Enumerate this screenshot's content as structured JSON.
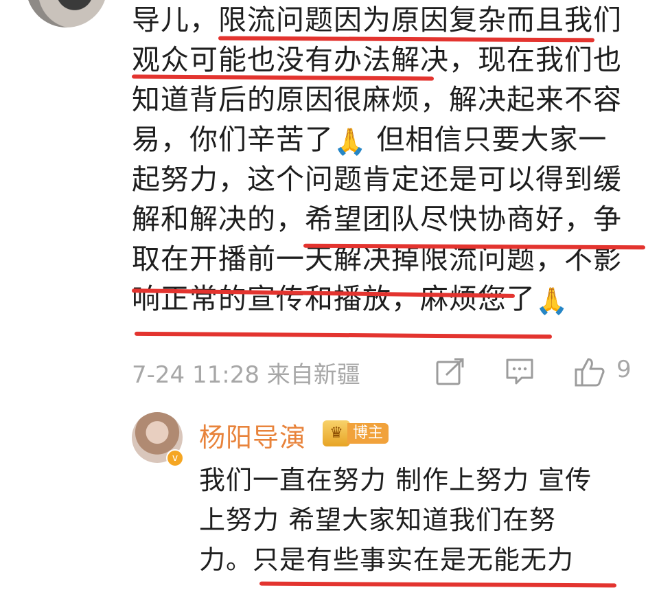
{
  "comment": {
    "lines": [
      "导儿，限流问题因为原因复杂而且我们",
      "观众可能也没有办法解决，现在我们也",
      "知道背后的原因很麻烦，解决起来不容",
      "易，你们辛苦了",
      "但相信只要大家一",
      "起努力，这个问题肯定还是可以得到缓",
      "解和解决的，希望团队尽快协商好，争",
      "取在开播前一天解决掉限流问题，不影",
      "响正常的宣传和播放，麻烦您了"
    ],
    "emoji": "🙏",
    "meta": {
      "time_location": "7-24 11:28 来自新疆",
      "like_count": "9"
    }
  },
  "reply": {
    "name": "杨阳导演",
    "badge": "博主",
    "lines": [
      "我们一直在努力 制作上努力 宣传",
      "上努力 希望大家知道我们在努",
      "力。只是有些事实在是无能无力"
    ]
  },
  "highlight_color": "#e3342f",
  "name_color": "#e8833b"
}
